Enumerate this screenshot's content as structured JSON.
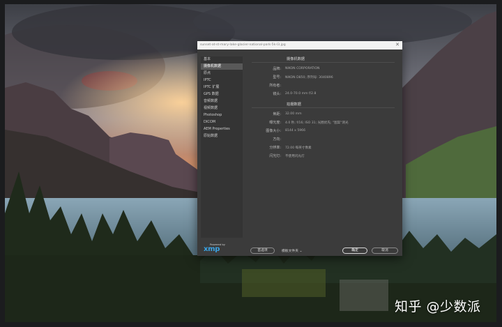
{
  "window": {
    "title": "sunset-at-st-mary-lake-glacier-national-park-5k-l3.jpg",
    "close_glyph": "✕"
  },
  "sidebar": {
    "items": [
      {
        "label": "基本",
        "active": false
      },
      {
        "label": "摄像机数据",
        "active": true
      },
      {
        "label": "原点",
        "active": false
      },
      {
        "label": "IPTC",
        "active": false
      },
      {
        "label": "IPTC 扩展",
        "active": false
      },
      {
        "label": "GPS 数据",
        "active": false
      },
      {
        "label": "音频数据",
        "active": false
      },
      {
        "label": "视频数据",
        "active": false
      },
      {
        "label": "Photoshop",
        "active": false
      },
      {
        "label": "DICOM",
        "active": false
      },
      {
        "label": "AEM Properties",
        "active": false
      },
      {
        "label": "原始数据",
        "active": false
      }
    ]
  },
  "camera": {
    "title": "摄像机数据",
    "rows": [
      {
        "label": "品牌:",
        "value": "NIKON CORPORATION"
      },
      {
        "label": "型号:",
        "value": "NIKON D850; 序列号: 3040896"
      },
      {
        "label": "所有者:",
        "value": ""
      },
      {
        "label": "镜头:",
        "value": "24.0-70.0 mm f/2.8"
      }
    ]
  },
  "capture": {
    "title": "拍摄数据",
    "rows": [
      {
        "label": "焦距:",
        "value": "32.00 mm"
      },
      {
        "label": "曝光度:",
        "value": "4.0 秒; f/16; ISO 31; 光圈优先; \"图案\"测光"
      },
      {
        "label": "图像大小:",
        "value": "8144 x 5966"
      },
      {
        "label": "方向:",
        "value": ""
      },
      {
        "label": "分辨率:",
        "value": "72.00 每英寸像素"
      },
      {
        "label": "闪光灯:",
        "value": "不使用闪光灯"
      }
    ]
  },
  "footer": {
    "powered_by": "Powered by",
    "logo_text": "xmp",
    "preferences_button": "首选项",
    "template_dropdown": "模板文件夹 ⌄",
    "ok_button": "确定",
    "cancel_button": "取消"
  },
  "watermark": "知乎 @少数派"
}
